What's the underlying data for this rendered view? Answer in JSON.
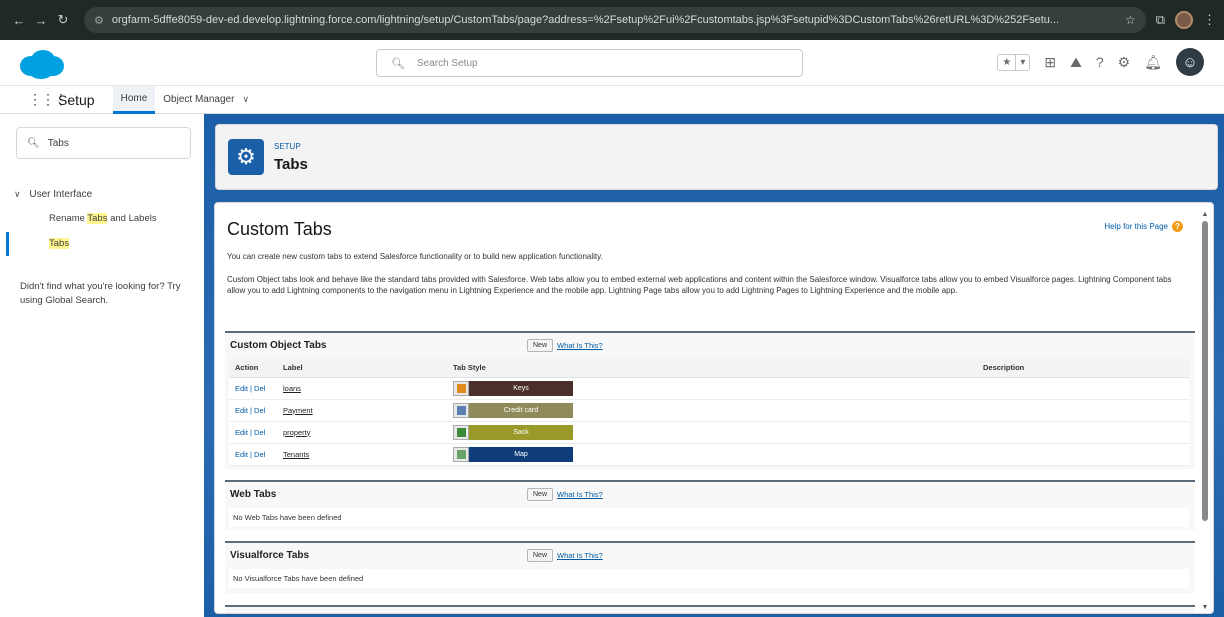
{
  "browser": {
    "url": "orgfarm-5dffe8059-dev-ed.develop.lightning.force.com/lightning/setup/CustomTabs/page?address=%2Fsetup%2Fui%2Fcustomtabs.jsp%3Fsetupid%3DCustomTabs%26retURL%3D%252Fsetu..."
  },
  "header": {
    "search_placeholder": "Search Setup"
  },
  "app_nav": {
    "app_name": "Setup",
    "tabs": [
      {
        "label": "Home",
        "active": true
      },
      {
        "label": "Object Manager",
        "active": false
      }
    ]
  },
  "sidebar": {
    "quick_find_value": "Tabs",
    "section_label": "User Interface",
    "items": [
      {
        "label_prefix": "Rename ",
        "label_highlight": "Tabs",
        "label_suffix": " and Labels"
      },
      {
        "label_prefix": "",
        "label_highlight": "Tabs",
        "label_suffix": ""
      }
    ],
    "not_found_text": "Didn't find what you're looking for? Try using Global Search."
  },
  "setup_header": {
    "eyebrow": "SETUP",
    "title": "Tabs"
  },
  "page": {
    "title": "Custom Tabs",
    "help_link": "Help for this Page",
    "intro_1": "You can create new custom tabs to extend Salesforce functionality or to build new application functionality.",
    "intro_2": "Custom Object tabs look and behave like the standard tabs provided with Salesforce. Web tabs allow you to embed external web applications and content within the Salesforce window. Visualforce tabs allow you to embed Visualforce pages. Lightning Component tabs allow you to add Lightning components to the navigation menu in Lightning Experience and the mobile app. Lightning Page tabs allow you to add Lightning Pages to Lightning Experience and the mobile app."
  },
  "sections": {
    "custom_object": {
      "title": "Custom Object Tabs",
      "new_label": "New",
      "what_label": "What Is This?",
      "columns": [
        "Action",
        "Label",
        "Tab Style",
        "Description"
      ],
      "rows": [
        {
          "action": "Edit | Del",
          "label": "loans",
          "style_name": "Keys",
          "style_color": "#4a2f2a",
          "style_icon_color": "#e08a1e"
        },
        {
          "action": "Edit | Del",
          "label": "Payment",
          "style_name": "Credit card",
          "style_color": "#8e8a5a",
          "style_icon_color": "#5a7fb5"
        },
        {
          "action": "Edit | Del",
          "label": "property",
          "style_name": "Sack",
          "style_color": "#9a9a2a",
          "style_icon_color": "#3a8a3a"
        },
        {
          "action": "Edit | Del",
          "label": "Tenants",
          "style_name": "Map",
          "style_color": "#0f3d7a",
          "style_icon_color": "#6aa36a"
        }
      ]
    },
    "web": {
      "title": "Web Tabs",
      "new_label": "New",
      "what_label": "What Is This?",
      "empty_text": "No Web Tabs have been defined"
    },
    "visualforce": {
      "title": "Visualforce Tabs",
      "new_label": "New",
      "what_label": "What Is This?",
      "empty_text": "No Visualforce Tabs have been defined"
    }
  }
}
